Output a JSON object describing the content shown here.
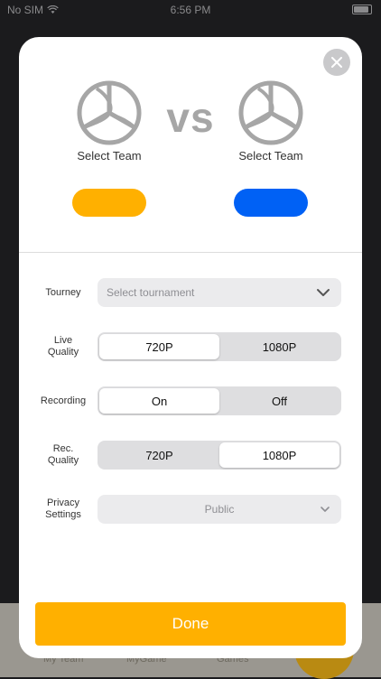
{
  "status_bar": {
    "carrier": "No SIM",
    "time": "6:56 PM"
  },
  "tab_bar": {
    "tabs": [
      "My Team",
      "MyGame",
      "Games"
    ]
  },
  "match": {
    "vs_label": "vs",
    "team_left": {
      "label": "Select Team",
      "color": "#ffb000"
    },
    "team_right": {
      "label": "Select Team",
      "color": "#0061f5"
    }
  },
  "settings": {
    "tourney": {
      "label": "Tourney",
      "placeholder": "Select tournament"
    },
    "live_quality": {
      "label_line1": "Live",
      "label_line2": "Quality",
      "options": [
        "720P",
        "1080P"
      ],
      "selected": "720P"
    },
    "recording": {
      "label": "Recording",
      "options": [
        "On",
        "Off"
      ],
      "selected": "On"
    },
    "rec_quality": {
      "label_line1": "Rec.",
      "label_line2": "Quality",
      "options": [
        "720P",
        "1080P"
      ],
      "selected": "1080P"
    },
    "privacy": {
      "label_line1": "Privacy",
      "label_line2": "Settings",
      "value": "Public"
    }
  },
  "done_label": "Done",
  "colors": {
    "accent": "#ffb000",
    "blue": "#0061f5",
    "modal_bg": "#ffffff"
  }
}
